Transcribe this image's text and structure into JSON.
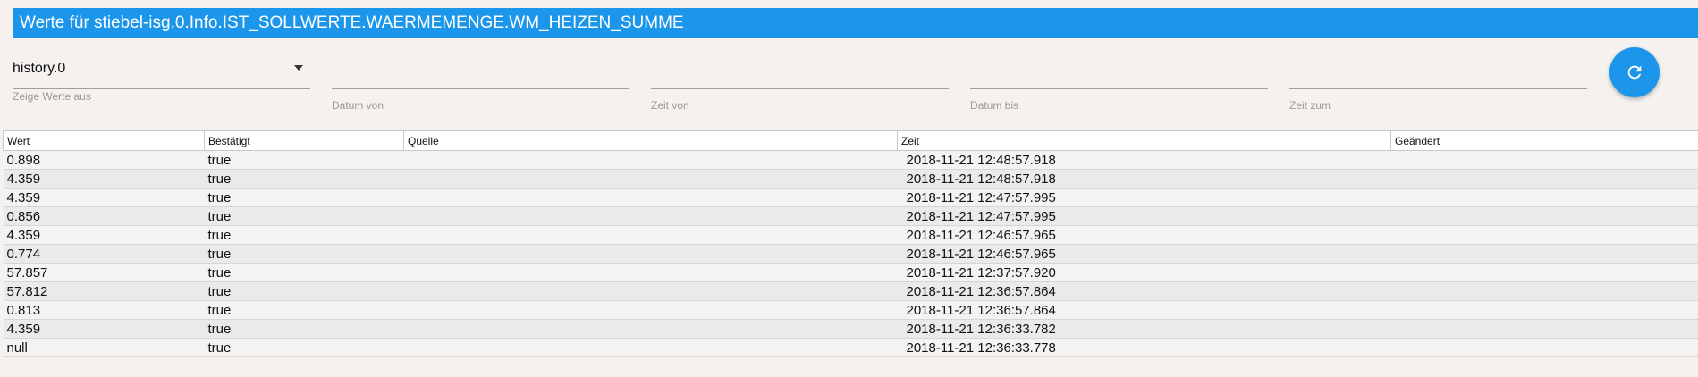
{
  "title": "Werte für stiebel-isg.0.Info.IST_SOLLWERTE.WAERMEMENGE.WM_HEIZEN_SUMME",
  "filters": {
    "instance": {
      "value": "history.0",
      "label": "Zeige Werte aus"
    },
    "date_from": {
      "value": "",
      "label": "Datum von"
    },
    "time_from": {
      "value": "",
      "label": "Zeit von"
    },
    "date_to": {
      "value": "",
      "label": "Datum bis"
    },
    "time_to": {
      "value": "",
      "label": "Zeit zum"
    }
  },
  "refresh": {
    "icon": "refresh-icon"
  },
  "accent_color": "#1c96ea",
  "table": {
    "columns": [
      "Wert",
      "Bestätigt",
      "Quelle",
      "Zeit",
      "Geändert"
    ],
    "rows": [
      {
        "wert": "0.898",
        "ack": "true",
        "quelle": "",
        "zeit": "2018-11-21 12:48:57.918",
        "geaendert": ""
      },
      {
        "wert": "4.359",
        "ack": "true",
        "quelle": "",
        "zeit": "2018-11-21 12:48:57.918",
        "geaendert": ""
      },
      {
        "wert": "4.359",
        "ack": "true",
        "quelle": "",
        "zeit": "2018-11-21 12:47:57.995",
        "geaendert": ""
      },
      {
        "wert": "0.856",
        "ack": "true",
        "quelle": "",
        "zeit": "2018-11-21 12:47:57.995",
        "geaendert": ""
      },
      {
        "wert": "4.359",
        "ack": "true",
        "quelle": "",
        "zeit": "2018-11-21 12:46:57.965",
        "geaendert": ""
      },
      {
        "wert": "0.774",
        "ack": "true",
        "quelle": "",
        "zeit": "2018-11-21 12:46:57.965",
        "geaendert": ""
      },
      {
        "wert": "57.857",
        "ack": "true",
        "quelle": "",
        "zeit": "2018-11-21 12:37:57.920",
        "geaendert": ""
      },
      {
        "wert": "57.812",
        "ack": "true",
        "quelle": "",
        "zeit": "2018-11-21 12:36:57.864",
        "geaendert": ""
      },
      {
        "wert": "0.813",
        "ack": "true",
        "quelle": "",
        "zeit": "2018-11-21 12:36:57.864",
        "geaendert": ""
      },
      {
        "wert": "4.359",
        "ack": "true",
        "quelle": "",
        "zeit": "2018-11-21 12:36:33.782",
        "geaendert": ""
      },
      {
        "wert": "null",
        "ack": "true",
        "quelle": "",
        "zeit": "2018-11-21 12:36:33.778",
        "geaendert": ""
      }
    ]
  }
}
